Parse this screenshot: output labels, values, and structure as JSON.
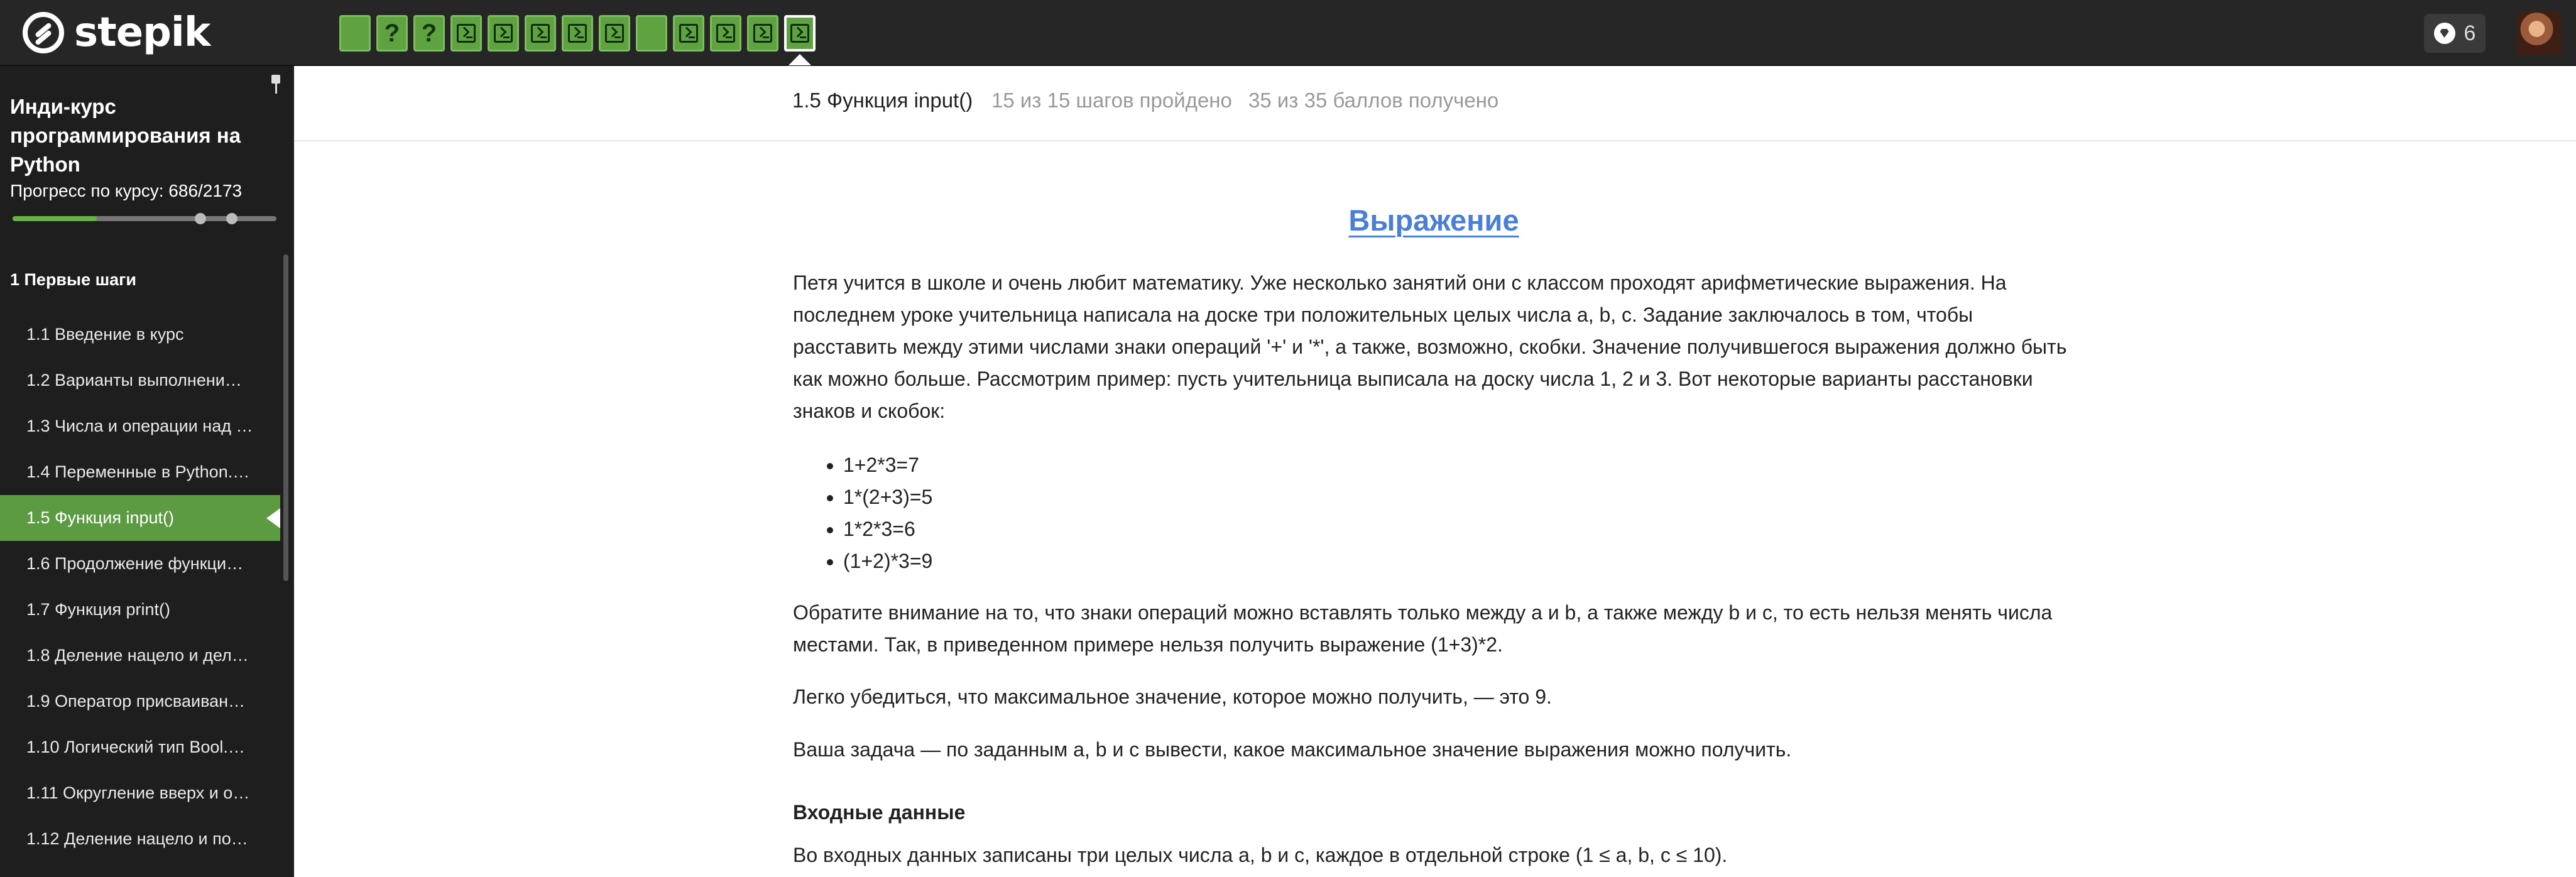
{
  "app": {
    "logo_text": "stepik"
  },
  "steps": [
    {
      "kind": "done",
      "glyph": ""
    },
    {
      "kind": "quiz",
      "glyph": "?"
    },
    {
      "kind": "quiz",
      "glyph": "?"
    },
    {
      "kind": "code",
      "glyph": ""
    },
    {
      "kind": "code",
      "glyph": ""
    },
    {
      "kind": "code",
      "glyph": ""
    },
    {
      "kind": "code",
      "glyph": ""
    },
    {
      "kind": "code",
      "glyph": ""
    },
    {
      "kind": "done",
      "glyph": ""
    },
    {
      "kind": "code",
      "glyph": ""
    },
    {
      "kind": "code",
      "glyph": ""
    },
    {
      "kind": "code",
      "glyph": ""
    },
    {
      "kind": "code-current",
      "glyph": ""
    }
  ],
  "header": {
    "gems_count": "6"
  },
  "sidebar": {
    "course_title": "Инди-курс программирования на Python",
    "progress_label": "Прогресс по курсу:  686/2173",
    "progress_fraction": 0.32,
    "module_title": "1  Первые шаги",
    "lessons": [
      "1.1  Введение в курс",
      "1.2  Варианты выполнени…",
      "1.3  Числа и операции над …",
      "1.4  Переменные в Python.…",
      "1.5  Функция input()",
      "1.6  Продолжение функци…",
      "1.7  Функция print()",
      "1.8  Деление нацело и дел…",
      "1.9  Оператор присваиван…",
      "1.10  Логический тип Bool.…",
      "1.11  Округление вверх и о…",
      "1.12  Деление нацело и по…"
    ],
    "active_index": 4
  },
  "lesson_header": {
    "title": "1.5 Функция input()",
    "steps_passed": "15 из 15 шагов пройдено",
    "points": "35 из 35 баллов  получено"
  },
  "content": {
    "title": "Выражение",
    "para1": "Петя учится в школе и очень любит математику. Уже несколько занятий они с классом проходят арифметические выражения. На последнем уроке учительница написала на доске три положительных целых числа a, b, c. Задание заключалось в том, чтобы расставить между этими числами знаки операций '+' и '*', а также, возможно, скобки. Значение получившегося выражения должно быть как можно больше. Рассмотрим пример: пусть учительница выписала на доску числа 1, 2 и 3. Вот некоторые варианты расстановки знаков и скобок:",
    "examples": [
      "1+2*3=7",
      "1*(2+3)=5",
      "1*2*3=6",
      "(1+2)*3=9"
    ],
    "para2": "Обратите внимание на то, что знаки операций можно вставлять только между a и b, а также между b и c, то есть нельзя менять числа местами. Так, в приведенном примере нельзя получить выражение (1+3)*2.",
    "para3": "Легко убедиться, что максимальное значение, которое можно получить, — это 9.",
    "para4": "Ваша задача — по заданным a, b и c вывести, какое максимальное значение выражения можно получить.",
    "input_heading": "Входные данные",
    "para5": "Во входных данных записаны три целых числа a, b и c, каждое в отдельной строке (1 ≤ a, b, c ≤ 10)."
  }
}
